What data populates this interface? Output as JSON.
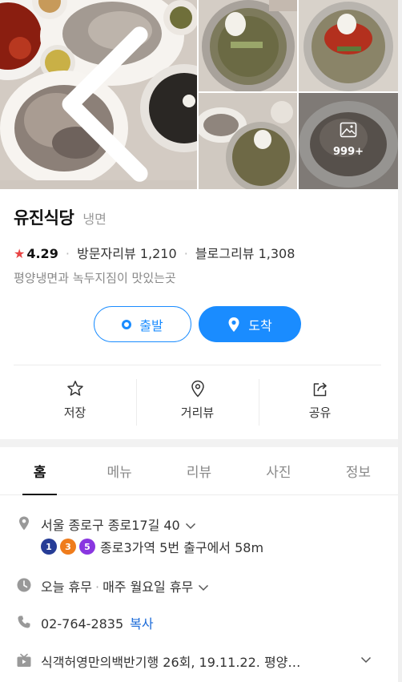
{
  "gallery": {
    "more_count": "999+"
  },
  "place": {
    "name": "유진식당",
    "category": "냉면",
    "rating": "4.29",
    "visitor_review_label": "방문자리뷰",
    "visitor_review_count": "1,210",
    "blog_review_label": "블로그리뷰",
    "blog_review_count": "1,308",
    "description": "평양냉면과 녹두지짐이 맛있는곳"
  },
  "route": {
    "start_label": "출발",
    "end_label": "도착"
  },
  "actions": [
    {
      "label": "저장",
      "icon": "star-icon"
    },
    {
      "label": "거리뷰",
      "icon": "map-pin-outline-icon"
    },
    {
      "label": "공유",
      "icon": "share-icon"
    }
  ],
  "tabs": [
    "홈",
    "메뉴",
    "리뷰",
    "사진",
    "정보"
  ],
  "active_tab": "홈",
  "info": {
    "address": "서울 종로구 종로17길 40",
    "subway_lines": [
      {
        "number": "1",
        "color": "#263c96"
      },
      {
        "number": "3",
        "color": "#ef7c1c"
      },
      {
        "number": "5",
        "color": "#8936e0"
      }
    ],
    "subway_text": "종로3가역 5번 출구에서 58m",
    "hours_status": "오늘 휴무",
    "hours_detail": "매주 월요일 휴무",
    "phone": "02-764-2835",
    "copy_label": "복사",
    "tv": "식객허영만의백반기행 26회, 19.11.22. 평양…"
  },
  "colors": {
    "accent": "#1a8cff",
    "star": "#e84444"
  }
}
